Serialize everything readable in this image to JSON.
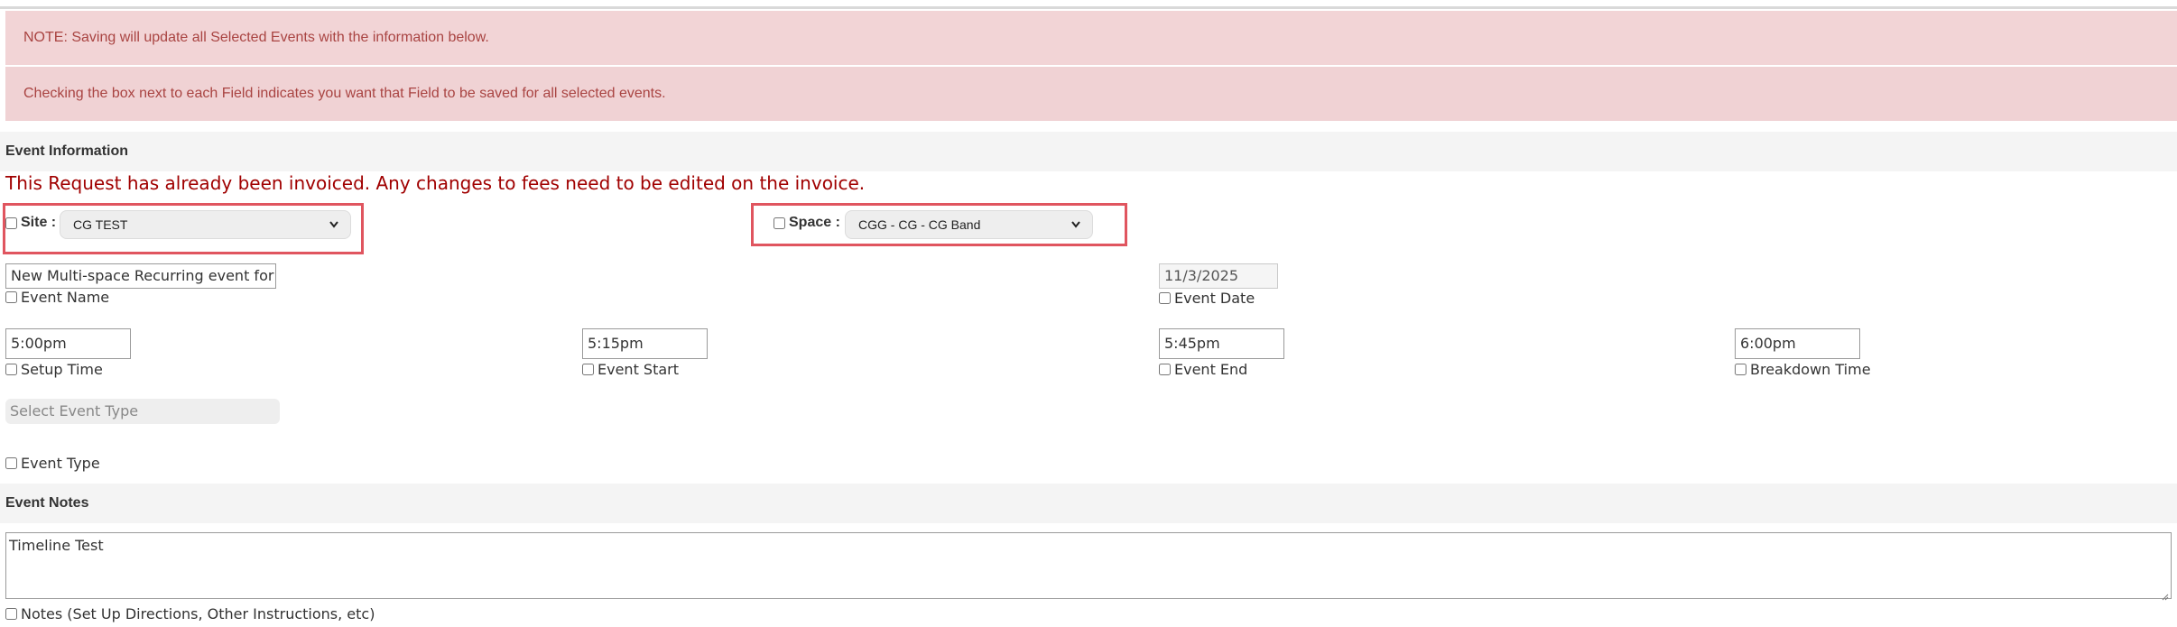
{
  "alerts": {
    "note": "NOTE: Saving will update all Selected Events with the information below.",
    "checking": "Checking the box next to each Field indicates you want that Field to be saved for all selected events."
  },
  "event_information": {
    "header": "Event Information",
    "invoice_warning": "This Request has already been invoiced. Any changes to fees need to be edited on the invoice.",
    "site": {
      "label": "Site :",
      "value": "CG TEST"
    },
    "space": {
      "label": "Space :",
      "value": "CGG - CG - CG Band"
    },
    "event_name": {
      "value": "New Multi-space Recurring event for ti",
      "label": "Event Name"
    },
    "event_date": {
      "value": "11/3/2025",
      "label": "Event Date"
    },
    "setup_time": {
      "value": "5:00pm",
      "label": "Setup Time"
    },
    "event_start": {
      "value": "5:15pm",
      "label": "Event Start"
    },
    "event_end": {
      "value": "5:45pm",
      "label": "Event End"
    },
    "breakdown_time": {
      "value": "6:00pm",
      "label": "Breakdown Time"
    },
    "event_type": {
      "placeholder": "Select Event Type",
      "label": "Event Type"
    }
  },
  "event_notes": {
    "header": "Event Notes",
    "value": "Timeline Test",
    "label": "Notes (Set Up Directions, Other Instructions, etc)"
  },
  "colors": {
    "alert_bg": "#f2d4d6",
    "alert_text": "#a94442",
    "warning_text": "#a00000",
    "highlight_border": "#e0555f"
  },
  "icons": {
    "dropdown": "chevron-down-icon"
  }
}
